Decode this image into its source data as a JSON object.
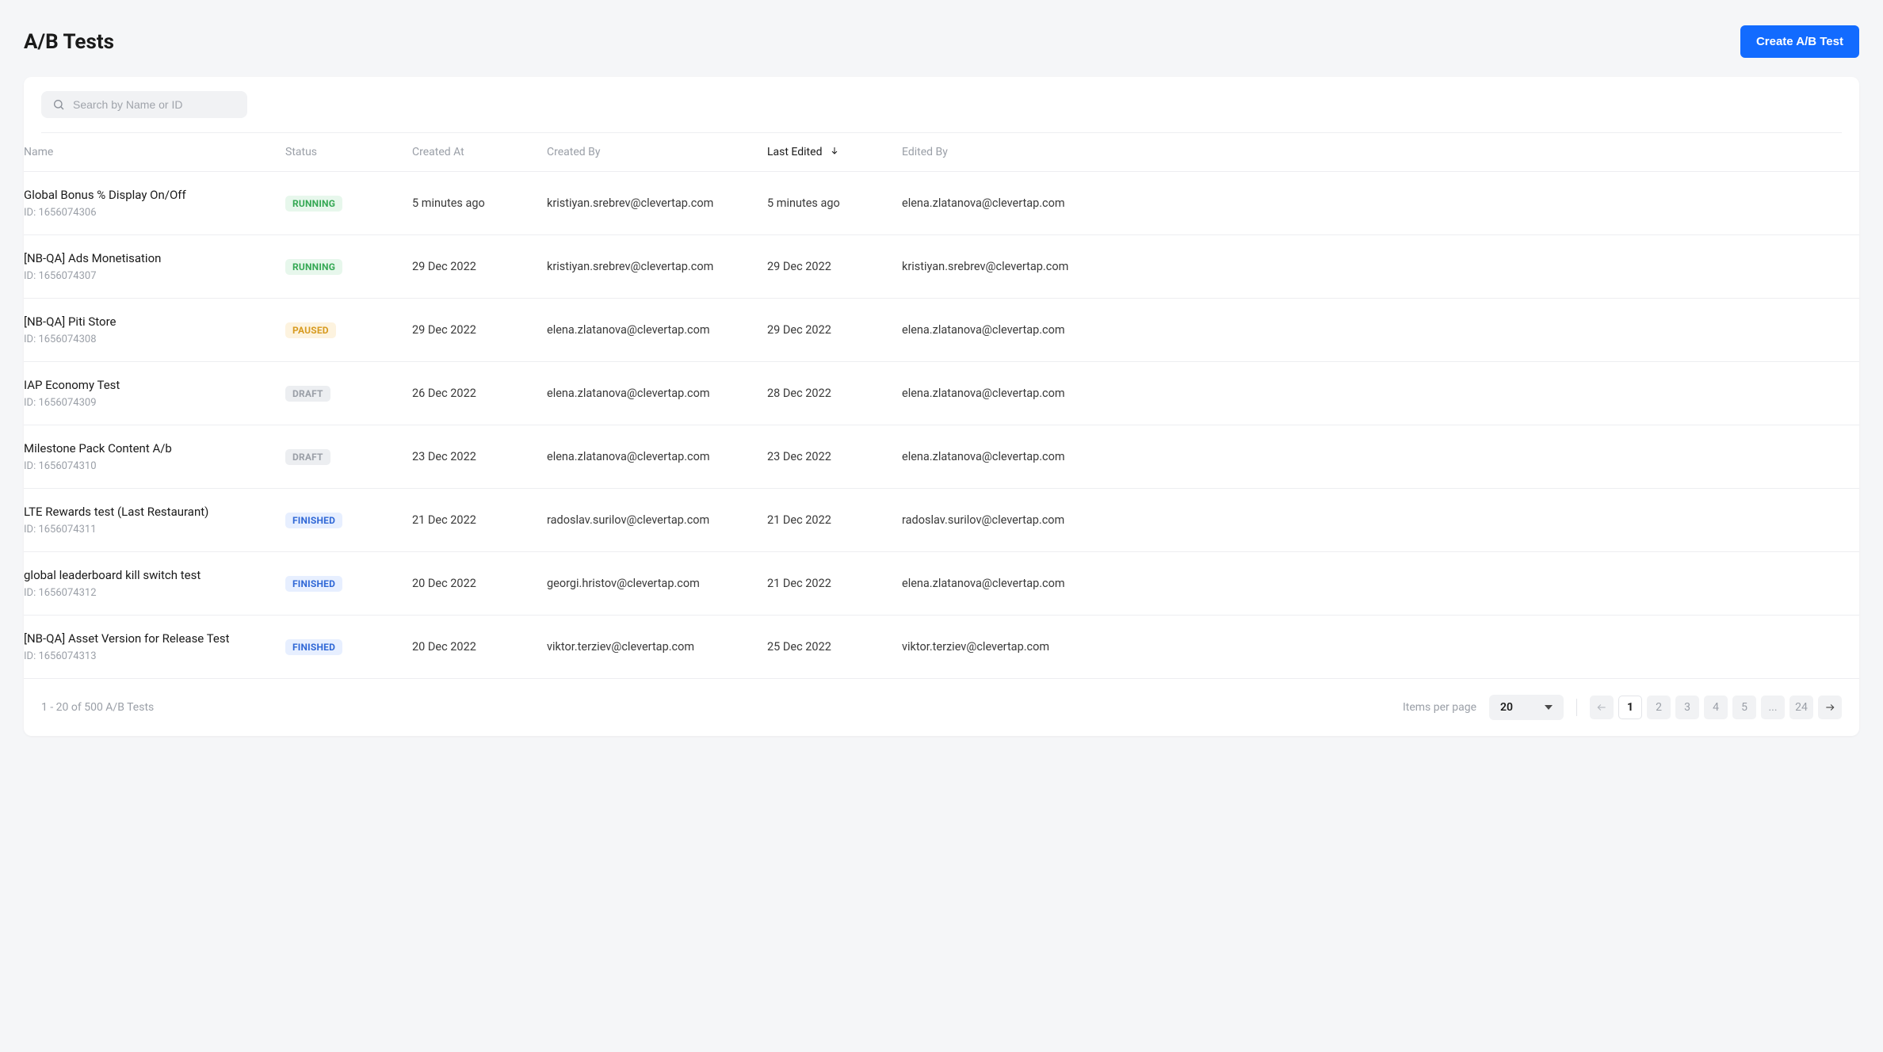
{
  "header": {
    "title": "A/B Tests",
    "create_label": "Create A/B Test"
  },
  "search": {
    "placeholder": "Search by Name or ID",
    "value": ""
  },
  "table": {
    "columns": {
      "name": "Name",
      "status": "Status",
      "created_at": "Created At",
      "created_by": "Created By",
      "last_edited": "Last Edited",
      "edited_by": "Edited By"
    },
    "sort": {
      "column": "last_edited",
      "direction": "desc"
    },
    "rows": [
      {
        "name": "Global Bonus % Display On/Off",
        "id": "ID: 1656074306",
        "status": "RUNNING",
        "status_class": "running",
        "created_at": "5 minutes ago",
        "created_by": "kristiyan.srebrev@clevertap.com",
        "last_edited": "5 minutes ago",
        "edited_by": "elena.zlatanova@clevertap.com"
      },
      {
        "name": "[NB-QA] Ads Monetisation",
        "id": "ID: 1656074307",
        "status": "RUNNING",
        "status_class": "running",
        "created_at": "29 Dec 2022",
        "created_by": "kristiyan.srebrev@clevertap.com",
        "last_edited": "29 Dec 2022",
        "edited_by": "kristiyan.srebrev@clevertap.com"
      },
      {
        "name": "[NB-QA] Piti Store",
        "id": "ID: 1656074308",
        "status": "PAUSED",
        "status_class": "paused",
        "created_at": "29 Dec 2022",
        "created_by": "elena.zlatanova@clevertap.com",
        "last_edited": "29 Dec 2022",
        "edited_by": "elena.zlatanova@clevertap.com"
      },
      {
        "name": "IAP Economy Test",
        "id": "ID: 1656074309",
        "status": "DRAFT",
        "status_class": "draft",
        "created_at": "26 Dec 2022",
        "created_by": "elena.zlatanova@clevertap.com",
        "last_edited": "28 Dec 2022",
        "edited_by": "elena.zlatanova@clevertap.com"
      },
      {
        "name": "Milestone Pack Content A/b",
        "id": "ID: 1656074310",
        "status": "DRAFT",
        "status_class": "draft",
        "created_at": "23 Dec 2022",
        "created_by": "elena.zlatanova@clevertap.com",
        "last_edited": "23 Dec 2022",
        "edited_by": "elena.zlatanova@clevertap.com"
      },
      {
        "name": "LTE Rewards test (Last Restaurant)",
        "id": "ID: 1656074311",
        "status": "FINISHED",
        "status_class": "finished",
        "created_at": "21 Dec 2022",
        "created_by": "radoslav.surilov@clevertap.com",
        "last_edited": "21 Dec 2022",
        "edited_by": "radoslav.surilov@clevertap.com"
      },
      {
        "name": "global leaderboard kill switch test",
        "id": "ID: 1656074312",
        "status": "FINISHED",
        "status_class": "finished",
        "created_at": "20 Dec 2022",
        "created_by": "georgi.hristov@clevertap.com",
        "last_edited": "21 Dec 2022",
        "edited_by": "elena.zlatanova@clevertap.com"
      },
      {
        "name": "[NB-QA] Asset Version for Release Test",
        "id": "ID: 1656074313",
        "status": "FINISHED",
        "status_class": "finished",
        "created_at": "20 Dec 2022",
        "created_by": "viktor.terziev@clevertap.com",
        "last_edited": "25 Dec 2022",
        "edited_by": "viktor.terziev@clevertap.com"
      }
    ]
  },
  "footer": {
    "summary": "1 - 20 of 500 A/B Tests",
    "items_per_page_label": "Items per page",
    "items_per_page_value": "20",
    "pages": [
      "1",
      "2",
      "3",
      "4",
      "5",
      "...",
      "24"
    ],
    "current_page": "1"
  }
}
